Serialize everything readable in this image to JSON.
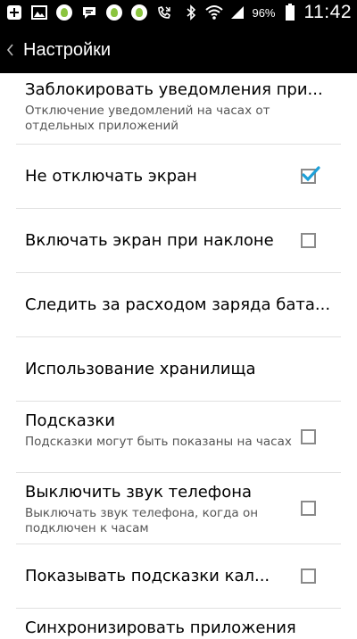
{
  "status_bar": {
    "battery_percent": "96%",
    "time": "11:42",
    "left_icons": [
      "add-box-icon",
      "gallery-icon",
      "app-icon",
      "chat-icon",
      "app-icon",
      "app-icon",
      "missed-call-icon"
    ],
    "right_icons": [
      "bluetooth-icon",
      "wifi-icon",
      "signal-icon",
      "battery-icon"
    ]
  },
  "action_bar": {
    "title": "Настройки"
  },
  "settings": [
    {
      "title": "Заблокировать уведомления при...",
      "subtitle": "Отключение уведомлений на часах от отдельных приложений",
      "checkbox": null
    },
    {
      "title": "Не отключать экран",
      "subtitle": "",
      "checkbox": true
    },
    {
      "title": "Включать экран при наклоне",
      "subtitle": "",
      "checkbox": false
    },
    {
      "title": "Следить за расходом заряда бата...",
      "subtitle": "",
      "checkbox": null
    },
    {
      "title": "Использование хранилища",
      "subtitle": "",
      "checkbox": null
    },
    {
      "title": "Подсказки",
      "subtitle": "Подсказки могут быть показаны на часах",
      "checkbox": false
    },
    {
      "title": "Выключить звук телефона",
      "subtitle": "Выключать звук телефона, когда он подключен к часам",
      "checkbox": false
    },
    {
      "title": "Показывать подсказки кал...",
      "subtitle": "",
      "checkbox": false
    },
    {
      "title": "Синхронизировать приложения",
      "subtitle": "",
      "checkbox": null
    }
  ],
  "colors": {
    "check_accent": "#1ea0d8",
    "status_bar_bg": "#000000",
    "app_icon_green": "#8bc53f"
  }
}
